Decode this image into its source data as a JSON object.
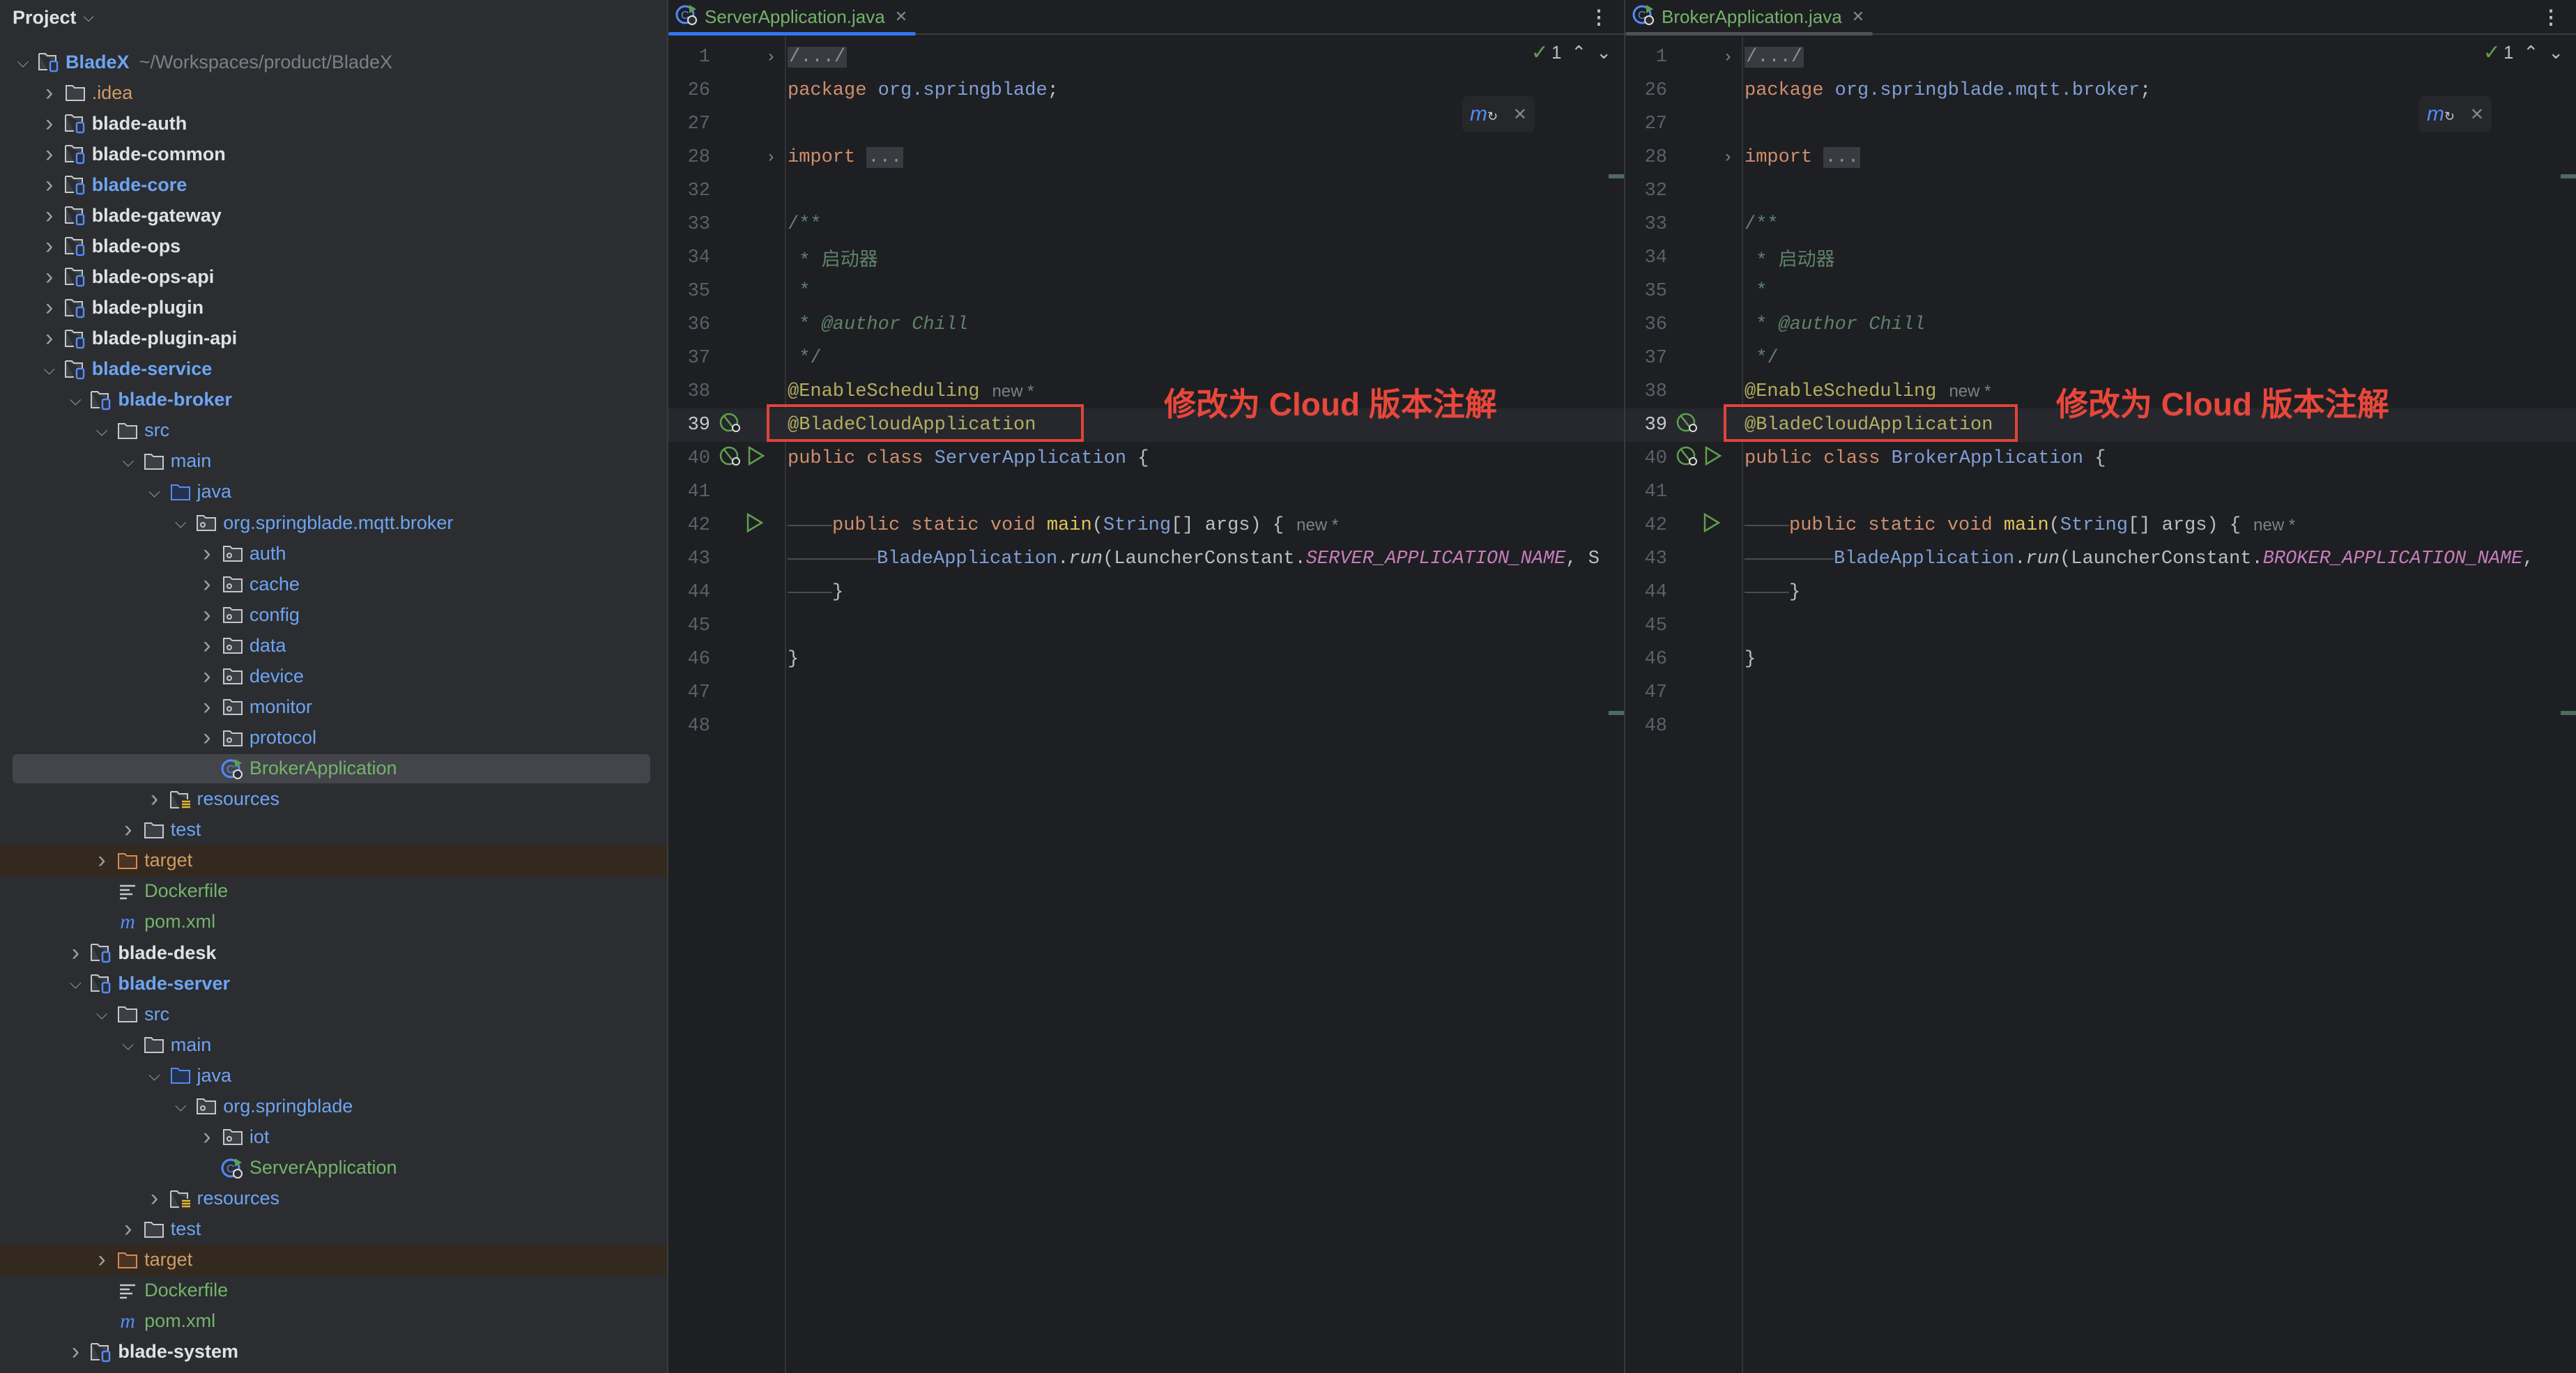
{
  "project_panel": {
    "title": "Project",
    "tree": [
      {
        "level": 0,
        "open": true,
        "icon": "module-folder-icon",
        "label": "BladeX",
        "color": "blue",
        "bold": true,
        "path": "~/Workspaces/product/BladeX"
      },
      {
        "level": 1,
        "open": false,
        "icon": "folder-icon",
        "label": ".idea",
        "color": "orange"
      },
      {
        "level": 1,
        "open": false,
        "icon": "module-folder-icon",
        "label": "blade-auth",
        "color": "white",
        "bold": true
      },
      {
        "level": 1,
        "open": false,
        "icon": "module-folder-icon",
        "label": "blade-common",
        "color": "white",
        "bold": true
      },
      {
        "level": 1,
        "open": false,
        "icon": "module-folder-icon",
        "label": "blade-core",
        "color": "blue",
        "bold": true
      },
      {
        "level": 1,
        "open": false,
        "icon": "module-folder-icon",
        "label": "blade-gateway",
        "color": "white",
        "bold": true
      },
      {
        "level": 1,
        "open": false,
        "icon": "module-folder-icon",
        "label": "blade-ops",
        "color": "white",
        "bold": true
      },
      {
        "level": 1,
        "open": false,
        "icon": "module-folder-icon",
        "label": "blade-ops-api",
        "color": "white",
        "bold": true
      },
      {
        "level": 1,
        "open": false,
        "icon": "module-folder-icon",
        "label": "blade-plugin",
        "color": "white",
        "bold": true
      },
      {
        "level": 1,
        "open": false,
        "icon": "module-folder-icon",
        "label": "blade-plugin-api",
        "color": "white",
        "bold": true
      },
      {
        "level": 1,
        "open": true,
        "icon": "module-folder-icon",
        "label": "blade-service",
        "color": "blue",
        "bold": true
      },
      {
        "level": 2,
        "open": true,
        "icon": "module-folder-icon",
        "label": "blade-broker",
        "color": "blue",
        "bold": true
      },
      {
        "level": 3,
        "open": true,
        "icon": "folder-icon",
        "label": "src",
        "color": "blue"
      },
      {
        "level": 4,
        "open": true,
        "icon": "folder-icon",
        "label": "main",
        "color": "blue"
      },
      {
        "level": 5,
        "open": true,
        "icon": "source-folder-icon",
        "label": "java",
        "color": "blue"
      },
      {
        "level": 6,
        "open": true,
        "icon": "package-icon",
        "label": "org.springblade.mqtt.broker",
        "color": "blue"
      },
      {
        "level": 7,
        "open": false,
        "icon": "package-icon",
        "label": "auth",
        "color": "blue"
      },
      {
        "level": 7,
        "open": false,
        "icon": "package-icon",
        "label": "cache",
        "color": "blue"
      },
      {
        "level": 7,
        "open": false,
        "icon": "package-icon",
        "label": "config",
        "color": "blue"
      },
      {
        "level": 7,
        "open": false,
        "icon": "package-icon",
        "label": "data",
        "color": "blue"
      },
      {
        "level": 7,
        "open": false,
        "icon": "package-icon",
        "label": "device",
        "color": "blue"
      },
      {
        "level": 7,
        "open": false,
        "icon": "package-icon",
        "label": "monitor",
        "color": "blue"
      },
      {
        "level": 7,
        "open": false,
        "icon": "package-icon",
        "label": "protocol",
        "color": "blue"
      },
      {
        "level": 7,
        "leaf": true,
        "icon": "spring-boot-class-icon",
        "label": "BrokerApplication",
        "color": "green",
        "selected": true
      },
      {
        "level": 5,
        "open": false,
        "icon": "resources-folder-icon",
        "label": "resources",
        "color": "blue"
      },
      {
        "level": 4,
        "open": false,
        "icon": "folder-icon",
        "label": "test",
        "color": "blue"
      },
      {
        "level": 3,
        "open": false,
        "icon": "excluded-folder-icon",
        "label": "target",
        "color": "orange",
        "excluded": true
      },
      {
        "level": 3,
        "leaf": true,
        "icon": "dockerfile-icon",
        "label": "Dockerfile",
        "color": "green"
      },
      {
        "level": 3,
        "leaf": true,
        "icon": "maven-pom-icon",
        "label": "pom.xml",
        "color": "green"
      },
      {
        "level": 2,
        "open": false,
        "icon": "module-folder-icon",
        "label": "blade-desk",
        "color": "white",
        "bold": true
      },
      {
        "level": 2,
        "open": true,
        "icon": "module-folder-icon",
        "label": "blade-server",
        "color": "blue",
        "bold": true
      },
      {
        "level": 3,
        "open": true,
        "icon": "folder-icon",
        "label": "src",
        "color": "blue"
      },
      {
        "level": 4,
        "open": true,
        "icon": "folder-icon",
        "label": "main",
        "color": "blue"
      },
      {
        "level": 5,
        "open": true,
        "icon": "source-folder-icon",
        "label": "java",
        "color": "blue"
      },
      {
        "level": 6,
        "open": true,
        "icon": "package-icon",
        "label": "org.springblade",
        "color": "blue"
      },
      {
        "level": 7,
        "open": false,
        "icon": "package-icon",
        "label": "iot",
        "color": "blue"
      },
      {
        "level": 7,
        "leaf": true,
        "icon": "spring-boot-class-icon",
        "label": "ServerApplication",
        "color": "green"
      },
      {
        "level": 5,
        "open": false,
        "icon": "resources-folder-icon",
        "label": "resources",
        "color": "blue"
      },
      {
        "level": 4,
        "open": false,
        "icon": "folder-icon",
        "label": "test",
        "color": "blue"
      },
      {
        "level": 3,
        "open": false,
        "icon": "excluded-folder-icon",
        "label": "target",
        "color": "orange",
        "excluded": true
      },
      {
        "level": 3,
        "leaf": true,
        "icon": "dockerfile-icon",
        "label": "Dockerfile",
        "color": "green"
      },
      {
        "level": 3,
        "leaf": true,
        "icon": "maven-pom-icon",
        "label": "pom.xml",
        "color": "green"
      },
      {
        "level": 2,
        "open": false,
        "icon": "module-folder-icon",
        "label": "blade-system",
        "color": "white",
        "bold": true
      }
    ]
  },
  "editors": [
    {
      "tab": "ServerApplication.java",
      "active": true,
      "inspection_count": "1",
      "annotation_note": "修改为 Cloud 版本注解",
      "lines": [
        {
          "n": "1",
          "fold": true,
          "t": [
            [
              "fld",
              "/.../"
            ]
          ]
        },
        {
          "n": "26",
          "t": [
            [
              "kw",
              "package "
            ],
            [
              "pk",
              "org.springblade"
            ],
            [
              "pl",
              ";"
            ]
          ]
        },
        {
          "n": "27",
          "t": []
        },
        {
          "n": "28",
          "fold": true,
          "t": [
            [
              "kw",
              "import "
            ],
            [
              "fld",
              "..."
            ]
          ]
        },
        {
          "n": "32",
          "t": []
        },
        {
          "n": "33",
          "t": [
            [
              "cm",
              "/**"
            ]
          ]
        },
        {
          "n": "34",
          "t": [
            [
              "cm",
              " * 启动器"
            ]
          ]
        },
        {
          "n": "35",
          "t": [
            [
              "cm",
              " *"
            ]
          ]
        },
        {
          "n": "36",
          "t": [
            [
              "cm",
              " * "
            ],
            [
              "cmi",
              "@author Chill"
            ]
          ]
        },
        {
          "n": "37",
          "t": [
            [
              "cm",
              " */"
            ]
          ]
        },
        {
          "n": "38",
          "t": [
            [
              "ann",
              "@EnableScheduling"
            ]
          ],
          "hint": "new *"
        },
        {
          "n": "39",
          "cur": true,
          "gutter": [
            "spring-bean-icon"
          ],
          "t": [
            [
              "ann",
              "@BladeCloudApplication"
            ]
          ]
        },
        {
          "n": "40",
          "gutter": [
            "spring-bean-icon",
            "run-icon"
          ],
          "t": [
            [
              "kw",
              "public class "
            ],
            [
              "cls",
              "ServerApplication "
            ],
            [
              "pl",
              "{"
            ]
          ]
        },
        {
          "n": "41",
          "t": []
        },
        {
          "n": "42",
          "gutter": [
            "run-icon"
          ],
          "indent": 1,
          "t": [
            [
              "kw",
              "public static void "
            ],
            [
              "fn",
              "main"
            ],
            [
              "pl",
              "("
            ],
            [
              "cls",
              "String"
            ],
            [
              "pl",
              "[] args) {"
            ]
          ],
          "hint": "new *"
        },
        {
          "n": "43",
          "indent": 2,
          "t": [
            [
              "cls",
              "BladeApplication"
            ],
            [
              "pl",
              "."
            ],
            [
              "it",
              "run"
            ],
            [
              "pl",
              "(LauncherConstant."
            ],
            [
              "cst",
              "SERVER_APPLICATION_NAME"
            ],
            [
              "pl",
              ", S"
            ]
          ]
        },
        {
          "n": "44",
          "indent": 1,
          "t": [
            [
              "pl",
              "}"
            ]
          ]
        },
        {
          "n": "45",
          "t": []
        },
        {
          "n": "46",
          "t": [
            [
              "pl",
              "}"
            ]
          ]
        },
        {
          "n": "47",
          "t": []
        },
        {
          "n": "48",
          "t": []
        }
      ]
    },
    {
      "tab": "BrokerApplication.java",
      "active": false,
      "inspection_count": "1",
      "annotation_note": "修改为 Cloud 版本注解",
      "lines": [
        {
          "n": "1",
          "fold": true,
          "t": [
            [
              "fld",
              "/.../"
            ]
          ]
        },
        {
          "n": "26",
          "t": [
            [
              "kw",
              "package "
            ],
            [
              "pk",
              "org.springblade.mqtt.broker"
            ],
            [
              "pl",
              ";"
            ]
          ]
        },
        {
          "n": "27",
          "t": []
        },
        {
          "n": "28",
          "fold": true,
          "t": [
            [
              "kw",
              "import "
            ],
            [
              "fld",
              "..."
            ]
          ]
        },
        {
          "n": "32",
          "t": []
        },
        {
          "n": "33",
          "t": [
            [
              "cm",
              "/**"
            ]
          ]
        },
        {
          "n": "34",
          "t": [
            [
              "cm",
              " * 启动器"
            ]
          ]
        },
        {
          "n": "35",
          "t": [
            [
              "cm",
              " *"
            ]
          ]
        },
        {
          "n": "36",
          "t": [
            [
              "cm",
              " * "
            ],
            [
              "cmi",
              "@author Chill"
            ]
          ]
        },
        {
          "n": "37",
          "t": [
            [
              "cm",
              " */"
            ]
          ]
        },
        {
          "n": "38",
          "t": [
            [
              "ann",
              "@EnableScheduling"
            ]
          ],
          "hint": "new *"
        },
        {
          "n": "39",
          "cur": true,
          "gutter": [
            "spring-bean-icon"
          ],
          "t": [
            [
              "ann",
              "@BladeCloudApplication"
            ]
          ]
        },
        {
          "n": "40",
          "gutter": [
            "spring-bean-icon",
            "run-icon"
          ],
          "t": [
            [
              "kw",
              "public class "
            ],
            [
              "cls",
              "BrokerApplication "
            ],
            [
              "pl",
              "{"
            ]
          ]
        },
        {
          "n": "41",
          "t": []
        },
        {
          "n": "42",
          "gutter": [
            "run-icon"
          ],
          "indent": 1,
          "t": [
            [
              "kw",
              "public static void "
            ],
            [
              "fn",
              "main"
            ],
            [
              "pl",
              "("
            ],
            [
              "cls",
              "String"
            ],
            [
              "pl",
              "[] args) {"
            ]
          ],
          "hint": "new *"
        },
        {
          "n": "43",
          "indent": 2,
          "t": [
            [
              "cls",
              "BladeApplication"
            ],
            [
              "pl",
              "."
            ],
            [
              "it",
              "run"
            ],
            [
              "pl",
              "(LauncherConstant."
            ],
            [
              "cst",
              "BROKER_APPLICATION_NAME"
            ],
            [
              "pl",
              ", "
            ]
          ]
        },
        {
          "n": "44",
          "indent": 1,
          "t": [
            [
              "pl",
              "}"
            ]
          ]
        },
        {
          "n": "45",
          "t": []
        },
        {
          "n": "46",
          "t": [
            [
              "pl",
              "}"
            ]
          ]
        },
        {
          "n": "47",
          "t": []
        },
        {
          "n": "48",
          "t": []
        }
      ]
    }
  ],
  "colors": {
    "accent": "#3574f0",
    "annotation_red": "#e0443a",
    "selection": "#43454a"
  }
}
